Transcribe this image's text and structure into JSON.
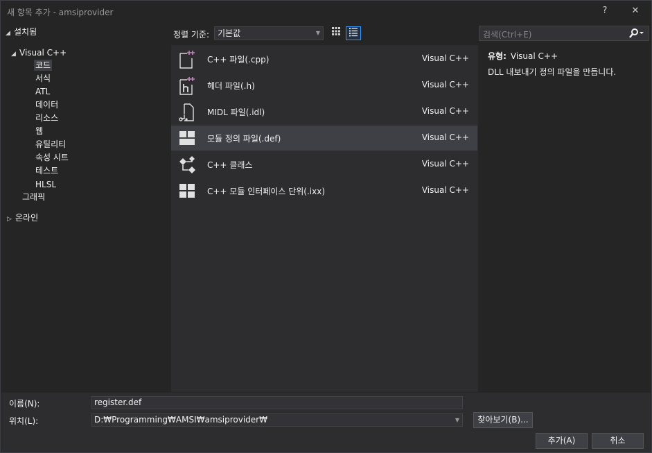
{
  "window": {
    "title": "새 항목 추가 - amsiprovider",
    "help": "?",
    "close": "✕"
  },
  "tree": {
    "installed": "설치됨",
    "visual_cpp": "Visual C++",
    "children": [
      "코드",
      "서식",
      "ATL",
      "데이터",
      "리소스",
      "웹",
      "유틸리티",
      "속성 시트",
      "테스트",
      "HLSL"
    ],
    "graphics": "그래픽",
    "online": "온라인"
  },
  "sortbar": {
    "label": "정렬 기준:",
    "value": "기본값"
  },
  "search": {
    "placeholder": "검색(Ctrl+E)"
  },
  "items": [
    {
      "name": "C++ 파일(.cpp)",
      "lang": "Visual C++",
      "icon": "cpp-file-icon"
    },
    {
      "name": "헤더 파일(.h)",
      "lang": "Visual C++",
      "icon": "header-file-icon"
    },
    {
      "name": "MIDL 파일(.idl)",
      "lang": "Visual C++",
      "icon": "midl-file-icon"
    },
    {
      "name": "모듈 정의 파일(.def)",
      "lang": "Visual C++",
      "icon": "module-def-icon"
    },
    {
      "name": "C++ 클래스",
      "lang": "Visual C++",
      "icon": "class-icon"
    },
    {
      "name": "C++ 모듈 인터페이스 단위(.ixx)",
      "lang": "Visual C++",
      "icon": "module-interface-icon"
    }
  ],
  "details": {
    "type_label": "유형:",
    "type_value": "Visual C++",
    "description": "DLL 내보내기 정의 파일을 만듭니다."
  },
  "bottom": {
    "name_label": "이름(N):",
    "name_value": "register.def",
    "location_label": "위치(L):",
    "location_value": "D:₩Programming₩AMSI₩amsiprovider₩",
    "browse": "찾아보기(B)...",
    "add": "추가(A)",
    "cancel": "취소"
  },
  "colors": {
    "accent": "#3399ff",
    "plus": "#c586c0",
    "selection": "#3f3f46"
  }
}
